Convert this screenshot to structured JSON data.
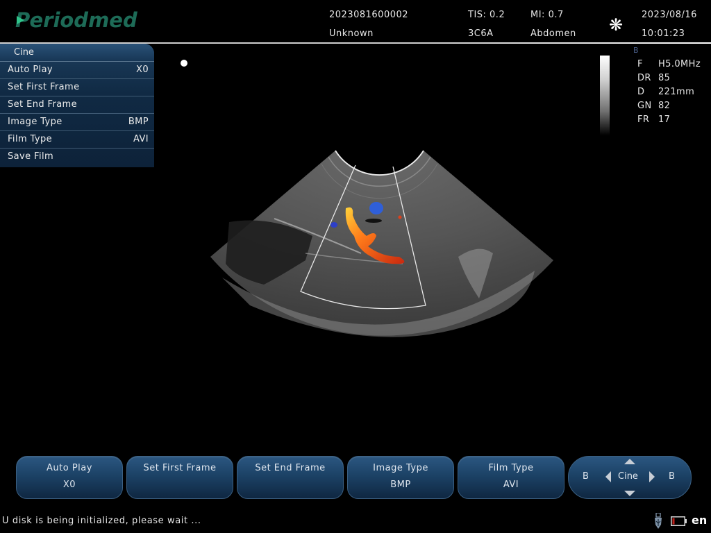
{
  "header": {
    "brand": "Periodmed",
    "patient_id": "2023081600002",
    "patient_name": "Unknown",
    "tis": "TIS: 0.2",
    "mi": "MI: 0.7",
    "probe": "3C6A",
    "preset": "Abdomen",
    "date": "2023/08/16",
    "time": "10:01:23",
    "freeze_icon": "snowflake-icon"
  },
  "cine_menu": {
    "title": "Cine",
    "items": [
      {
        "label": "Auto Play",
        "value": "X0"
      },
      {
        "label": "Set First Frame",
        "value": ""
      },
      {
        "label": "Set End Frame",
        "value": ""
      },
      {
        "label": "Image Type",
        "value": "BMP"
      },
      {
        "label": "Film Type",
        "value": "AVI"
      },
      {
        "label": "Save Film",
        "value": ""
      }
    ]
  },
  "image_params": {
    "mode": "B",
    "params": [
      {
        "key": "F",
        "value": "H5.0MHz"
      },
      {
        "key": "DR",
        "value": "85"
      },
      {
        "key": "D",
        "value": "221mm"
      },
      {
        "key": "GN",
        "value": "82"
      },
      {
        "key": "FR",
        "value": "17"
      }
    ]
  },
  "softkeys": [
    {
      "label": "Auto Play",
      "value": "X0"
    },
    {
      "label": "Set First Frame",
      "value": ""
    },
    {
      "label": "Set End Frame",
      "value": ""
    },
    {
      "label": "Image Type",
      "value": "BMP"
    },
    {
      "label": "Film Type",
      "value": "AVI"
    }
  ],
  "nav_control": {
    "center": "Cine",
    "left": "B",
    "right": "B"
  },
  "status": {
    "message": "U disk is being initialized, please wait ...",
    "language": "en",
    "usb_icon": "usb-icon",
    "battery_icon": "battery-low-icon",
    "battery_color": "#c0201a"
  }
}
